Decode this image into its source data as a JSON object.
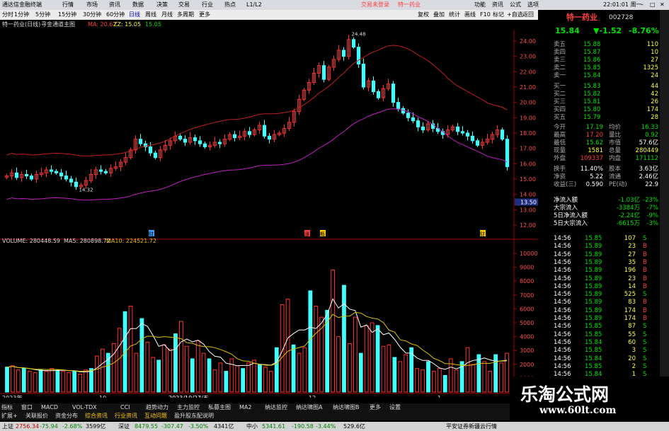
{
  "window": {
    "title": "通达信金融终端",
    "menu": [
      "行情",
      "市场",
      "资讯",
      "数据",
      "决策",
      "交易",
      "行业",
      "热点",
      "L1/L2"
    ],
    "center": "交易未登录",
    "stock": "特一药业",
    "time": "22:01:01 周一",
    "right": [
      "功能",
      "资讯",
      "公式",
      "选项"
    ]
  },
  "toolbar": {
    "periods": [
      "分时",
      "1分钟",
      "5分钟",
      "15分钟",
      "30分钟",
      "60分钟",
      "日线",
      "周线",
      "月线",
      "多周期",
      "更多"
    ],
    "right": [
      "复权",
      "叠加",
      "统计",
      "画线",
      "F10",
      "标记",
      "+自选",
      "返回"
    ]
  },
  "chart": {
    "stock_title": "特一药业(日线)",
    "indicator": "寻金通道主图",
    "ma_label": "MA: 20.67",
    "zz_label": "ZZ: 15.05",
    "val2": "15.05",
    "high_marker": "24.48",
    "low_marker": "14.32",
    "price_ticks": [
      "24.00",
      "23.00",
      "22.00",
      "21.00",
      "20.00",
      "19.00",
      "18.00",
      "17.00",
      "16.00",
      "15.00",
      "14.00",
      "13.00",
      "12.00"
    ],
    "current_price_tag": "13.50",
    "vol_title": "VOLUME: 280448.59",
    "vol_ma5": "MA5: 280898.72",
    "vol_ma10": "MA10: 224521.72",
    "vol_ticks": [
      "10000",
      "9000",
      "8000",
      "7000",
      "6000",
      "5000",
      "4000",
      "3000",
      "2000",
      "1000"
    ],
    "x_labels": [
      "2023年",
      "10",
      "2023/10/27/五",
      "12",
      "1"
    ],
    "markers": [
      "财",
      "涨",
      "概",
      "财"
    ]
  },
  "chart_data": {
    "type": "candlestick",
    "title": "特一药业(日线)",
    "high": 24.48,
    "low": 14.32,
    "colors": {
      "up": "#ff3030",
      "down": "#40ffff",
      "channel_upper": "#c02020",
      "channel_lower": "#c020c0",
      "ma5": "#ffffff",
      "ma10": "#e0c000"
    },
    "close": [
      15.2,
      15.4,
      15.1,
      15.3,
      15.2,
      15.0,
      15.3,
      15.4,
      15.6,
      15.5,
      15.4,
      15.2,
      15.0,
      14.8,
      14.5,
      14.6,
      14.9,
      15.3,
      15.6,
      15.5,
      15.4,
      15.7,
      15.8,
      16.1,
      16.4,
      16.9,
      17.6,
      17.3,
      17.1,
      16.7,
      16.4,
      16.9,
      17.2,
      17.5,
      17.8,
      17.6,
      17.4,
      17.7,
      17.5,
      17.3,
      17.1,
      17.2,
      17.4,
      17.3,
      17.6,
      17.9,
      17.7,
      17.8,
      18.1,
      17.9,
      18.2,
      18.5,
      17.8,
      17.6,
      17.9,
      18.0,
      18.3,
      18.7,
      19.4,
      20.2,
      20.8,
      21.3,
      21.9,
      22.4,
      21.5,
      22.3,
      22.8,
      23.4,
      23.0,
      24.1,
      23.6,
      22.5,
      21.0,
      21.4,
      20.7,
      20.3,
      20.9,
      21.2,
      20.0,
      19.6,
      19.3,
      19.0,
      18.8,
      18.4,
      18.2,
      18.6,
      18.3,
      18.1,
      17.9,
      18.2,
      18.4,
      18.1,
      18.0,
      17.8,
      17.5,
      17.2,
      17.4,
      17.6,
      17.9,
      18.2,
      17.6,
      15.8
    ],
    "volume": [
      1800,
      1900,
      1600,
      1700,
      1500,
      1400,
      1600,
      1500,
      1700,
      1600,
      1500,
      1400,
      1500,
      1300,
      1600,
      1700,
      2600,
      3100,
      2800,
      3500,
      4600,
      5800,
      6200,
      2800,
      5300,
      3600,
      2500,
      2300,
      3400,
      3100,
      4200,
      5100,
      3300,
      2400,
      3700,
      2800,
      2400,
      1600,
      2100,
      1500,
      2400,
      1900,
      1700,
      2100,
      2300,
      2000,
      1800,
      1500,
      3200,
      6300,
      6700,
      3400,
      2800,
      3200,
      7300,
      6200,
      5400,
      5900,
      8800,
      4000,
      7700,
      3500,
      5400,
      2800,
      4800,
      5000,
      4800,
      3300,
      3400,
      2500,
      2200,
      2700,
      3200,
      1700,
      1600,
      2200,
      1500,
      1700,
      1200,
      2400,
      1600,
      2200,
      3200,
      2000,
      2700,
      2200,
      1500,
      2700,
      2100,
      2800
    ]
  },
  "panel": {
    "name": "特一药业",
    "code": "002728",
    "price": "15.84",
    "change": "▼-1.52",
    "pct": "-8.76%",
    "sells": [
      [
        "卖五",
        "15.88",
        "110"
      ],
      [
        "卖四",
        "15.87",
        "10"
      ],
      [
        "卖三",
        "15.86",
        "27"
      ],
      [
        "卖二",
        "15.85",
        "1325"
      ],
      [
        "卖一",
        "15.84",
        "24"
      ]
    ],
    "buys": [
      [
        "买一",
        "15.83",
        "44"
      ],
      [
        "买二",
        "15.82",
        "42"
      ],
      [
        "买三",
        "15.81",
        "26"
      ],
      [
        "买四",
        "15.80",
        "174"
      ],
      [
        "买五",
        "15.79",
        "28"
      ]
    ],
    "stats": [
      [
        "今开",
        "17.19",
        "均价",
        "16.33"
      ],
      [
        "最高",
        "17.20",
        "量比",
        "0.92"
      ],
      [
        "最低",
        "15.62",
        "市值",
        "57.6亿"
      ],
      [
        "现量",
        "1581",
        "总量",
        "280449"
      ],
      [
        "外盘",
        "109337",
        "内盘",
        "171112"
      ],
      [
        "换手",
        "11.40%",
        "股本",
        "3.63亿"
      ],
      [
        "净资",
        "5.22",
        "流通",
        "2.46亿"
      ],
      [
        "收益(三)",
        "0.590",
        "PE(动)",
        "22.9"
      ]
    ],
    "flows": [
      [
        "净流入额",
        "-1.03亿",
        "-23%"
      ],
      [
        "大宗流入",
        "-3384万",
        "-7%"
      ],
      [
        "5日净流入额",
        "-2.24亿",
        "-9%"
      ],
      [
        "5日大宗流入",
        "-6615万",
        "-3%"
      ]
    ],
    "ticks": [
      [
        "14:56",
        "15.85",
        "107",
        "S"
      ],
      [
        "14:56",
        "15.89",
        "23",
        "B"
      ],
      [
        "14:56",
        "15.89",
        "27",
        "B"
      ],
      [
        "14:56",
        "15.89",
        "35",
        "B"
      ],
      [
        "14:56",
        "15.89",
        "196",
        "B"
      ],
      [
        "14:56",
        "15.89",
        "23",
        "B"
      ],
      [
        "14:56",
        "15.89",
        "14",
        "B"
      ],
      [
        "14:56",
        "15.89",
        "525",
        "S"
      ],
      [
        "14:56",
        "15.89",
        "83",
        "B"
      ],
      [
        "14:56",
        "15.89",
        "174",
        "B"
      ],
      [
        "14:56",
        "15.89",
        "174",
        "B"
      ],
      [
        "14:56",
        "15.85",
        "87",
        "S"
      ],
      [
        "14:56",
        "15.85",
        "55",
        "S"
      ],
      [
        "14:56",
        "15.84",
        "60",
        "S"
      ],
      [
        "14:56",
        "15.85",
        "3",
        "S"
      ],
      [
        "14:56",
        "15.84",
        "20",
        "S"
      ],
      [
        "14:56",
        "15.85",
        "2",
        "S"
      ],
      [
        "14:56",
        "15.84",
        "1",
        "S"
      ],
      [
        "14:56",
        "15.84",
        "20",
        "S"
      ]
    ]
  },
  "tabs": [
    "指标",
    "窗口",
    "MACD",
    "VOL-TDX",
    "CCI",
    "趋势动力",
    "主力监控",
    "私募主图",
    "MA2",
    "纳达监控",
    "纳达啸图A",
    "纳达啸图B",
    "更多",
    "设置"
  ],
  "tabs2": [
    "扩展+",
    "关联报价",
    "资金分布",
    "综合资讯",
    "行业资讯",
    "互动问题",
    "盈升股东配说明"
  ],
  "status": {
    "sh_label": "上证",
    "sh": "2756.34",
    "sh_chg": "-75.94",
    "sh_pct": "-2.68%",
    "sh_vol": "3599亿",
    "sz_label": "深证",
    "sz": "8479.55",
    "sz_chg": "-307.47",
    "sz_pct": "-3.50%",
    "sz_vol": "4341亿",
    "zx_label": "中小",
    "zx": "5341.61",
    "zx_chg": "-190.58",
    "zx_pct": "-3.44%",
    "zx_vol": "529.6亿",
    "broker": "平安证券新疆云行情"
  },
  "watermark": {
    "cn": "乐淘公式网",
    "url": "www.60lt.com"
  }
}
